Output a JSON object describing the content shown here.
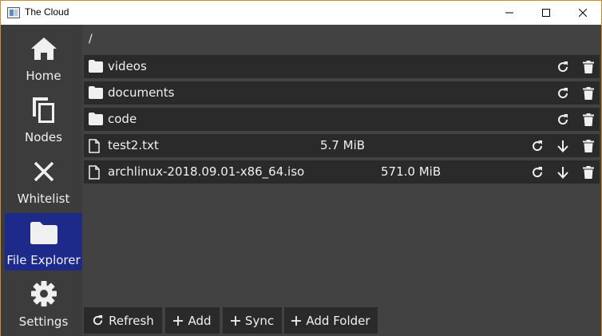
{
  "window": {
    "title": "The Cloud",
    "accent": "#1e2a8a"
  },
  "sidebar": {
    "items": [
      {
        "label": "Home",
        "icon": "home-icon",
        "active": false
      },
      {
        "label": "Nodes",
        "icon": "copy-icon",
        "active": false
      },
      {
        "label": "Whitelist",
        "icon": "x-icon",
        "active": false
      },
      {
        "label": "File Explorer",
        "icon": "folder-icon",
        "active": true
      },
      {
        "label": "Settings",
        "icon": "gear-icon",
        "active": false
      }
    ]
  },
  "explorer": {
    "path": "/",
    "entries": [
      {
        "name": "videos",
        "type": "folder",
        "size": ""
      },
      {
        "name": "documents",
        "type": "folder",
        "size": ""
      },
      {
        "name": "code",
        "type": "folder",
        "size": ""
      },
      {
        "name": "test2.txt",
        "type": "file",
        "size": "5.7 MiB"
      },
      {
        "name": "archlinux-2018.09.01-x86_64.iso",
        "type": "file",
        "size": "571.0 MiB"
      }
    ]
  },
  "toolbar": {
    "refresh_label": "Refresh",
    "add_label": "Add",
    "sync_label": "Sync",
    "add_folder_label": "Add Folder"
  }
}
